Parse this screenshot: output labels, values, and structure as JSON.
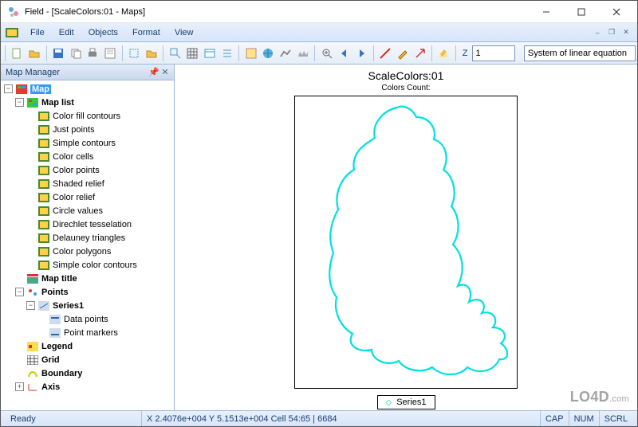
{
  "window": {
    "title": "Field - [ScaleColors:01 - Maps]"
  },
  "menu": {
    "file": "File",
    "edit": "Edit",
    "objects": "Objects",
    "format": "Format",
    "view": "View"
  },
  "toolbar": {
    "z_label": "Z",
    "number_value": "1",
    "combo_value": "System of linear equation"
  },
  "panel": {
    "title": "Map Manager"
  },
  "tree": {
    "map": "Map",
    "map_list": "Map list",
    "items": [
      "Color fill contours",
      "Just points",
      "Simple contours",
      "Color cells",
      "Color points",
      "Shaded relief",
      "Color relief",
      "Circle values",
      "Direchlet tesselation",
      "Delauney triangles",
      "Color polygons",
      "Simple color contours"
    ],
    "map_title": "Map title",
    "points": "Points",
    "series1": "Series1",
    "data_points": "Data points",
    "point_markers": "Point markers",
    "legend": "Legend",
    "grid": "Grid",
    "boundary": "Boundary",
    "axis": "Axis"
  },
  "chart": {
    "title": "ScaleColors:01",
    "subtitle": "Colors Count:",
    "legend_series": "Series1"
  },
  "status": {
    "ready": "Ready",
    "coords": "X 2.4076e+004 Y 5.1513e+004 Cell 54:65 | 6684",
    "cap": "CAP",
    "num": "NUM",
    "scrl": "SCRL"
  },
  "chart_data": {
    "type": "line",
    "title": "ScaleColors:01",
    "subtitle": "Colors Count:",
    "series": [
      {
        "name": "Series1",
        "color": "#00e0e0",
        "note": "closed irregular boundary polygon (contour outline)"
      }
    ],
    "xlim": [
      0,
      1
    ],
    "ylim": [
      0,
      1
    ]
  }
}
